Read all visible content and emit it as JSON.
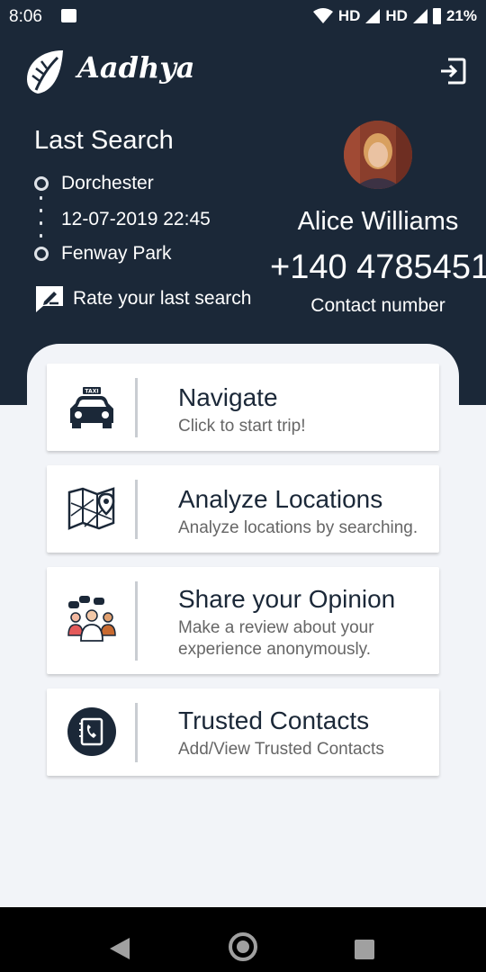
{
  "status_bar": {
    "time": "8:06",
    "network_1": "HD",
    "network_2": "HD",
    "battery": "21%"
  },
  "header": {
    "app_name": "Aadhya"
  },
  "last_search": {
    "title": "Last Search",
    "from": "Dorchester",
    "datetime": "12-07-2019 22:45",
    "to": "Fenway Park",
    "rate_label": "Rate your last search"
  },
  "profile": {
    "name": "Alice Williams",
    "phone": "+140 4785451",
    "phone_label": "Contact number"
  },
  "menu": [
    {
      "title": "Navigate",
      "subtitle": "Click to start trip!",
      "icon": "taxi-icon"
    },
    {
      "title": "Analyze Locations",
      "subtitle": "Analyze locations by searching.",
      "icon": "map-icon"
    },
    {
      "title": "Share your Opinion",
      "subtitle": "Make a review about your experience anonymously.",
      "icon": "people-chat-icon"
    },
    {
      "title": "Trusted Contacts",
      "subtitle": "Add/View Trusted Contacts",
      "icon": "phone-book-icon"
    }
  ],
  "colors": {
    "primary": "#1b2838",
    "background": "#f2f4f8",
    "card": "#ffffff"
  }
}
